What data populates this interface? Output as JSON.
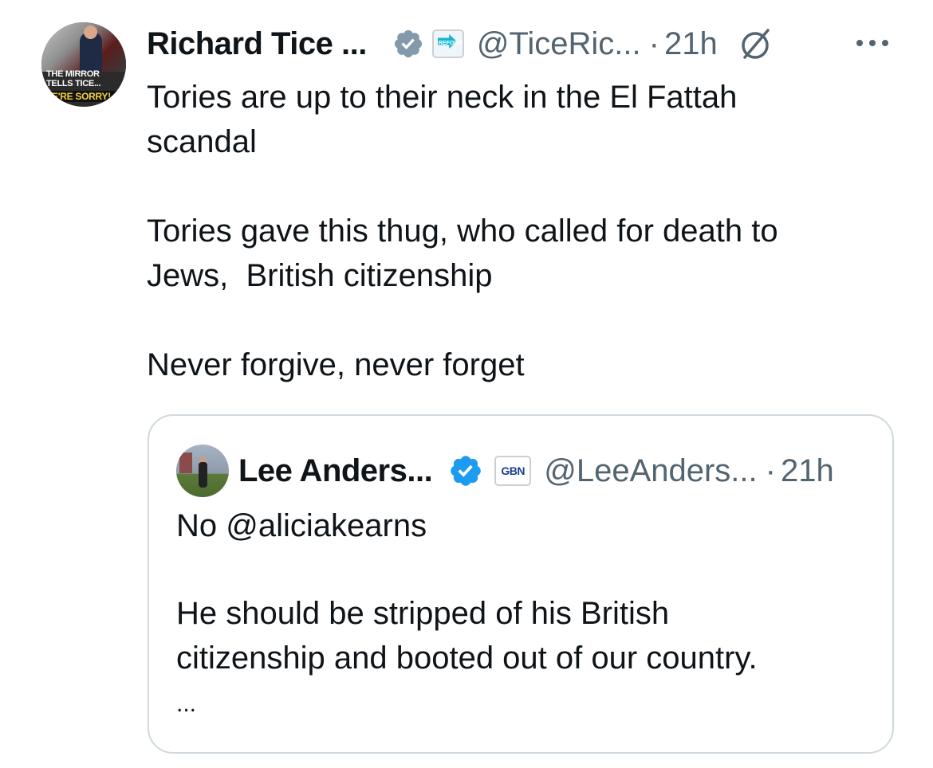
{
  "tweet": {
    "author_name": "Richard Tice ...",
    "handle": "@TiceRic...",
    "separator": "·",
    "time": "21h",
    "affiliation_badge_text": "REFORM UK",
    "avatar_text": {
      "line1": "THE MIRROR",
      "line2": "TELLS TICE...",
      "line3": "WE'RE SORRY!"
    },
    "paragraphs": [
      "Tories are up to their neck in the El Fattah\nscandal",
      "Tories gave this thug, who called for death to\nJews,  British citizenship",
      "Never forgive, never forget"
    ],
    "icons": {
      "verified": "verified-badge-icon",
      "grok": "grok-icon",
      "more": "more-options-icon"
    }
  },
  "quoted_tweet": {
    "author_name": "Lee Anders...",
    "affiliation_badge_text": "GBN",
    "handle": "@LeeAnders...",
    "separator": "·",
    "time": "21h",
    "paragraphs": [
      "No @aliciakearns",
      "He should be stripped of his British\ncitizenship and booted out of our country.",
      "..."
    ]
  },
  "colors": {
    "text_primary": "#0f1419",
    "text_secondary": "#536471",
    "verified_gray": "#829aab",
    "verified_blue": "#1d9bf0",
    "border": "#cfd9de"
  }
}
